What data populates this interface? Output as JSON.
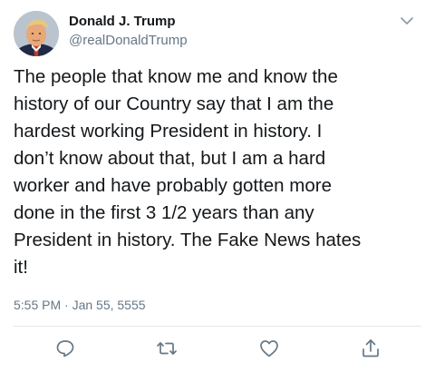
{
  "tweet": {
    "author_name": "Donald J. Trump",
    "author_handle": "@realDonaldTrump",
    "text": "The people that know me and know the\nhistory of our Country say that I am the\nhardest working President in history. I\ndon’t know about that, but I am a hard\nworker and have probably gotten more\ndone in the first 3 1/2 years than any\nPresident in history. The Fake News hates\nit!",
    "timestamp": "5:55 PM · Jan 55, 5555"
  },
  "icons": {
    "avatar": "profile-photo",
    "menu": "chevron-down-icon",
    "reply": "reply-icon",
    "retweet": "retweet-icon",
    "like": "heart-icon",
    "share": "share-icon"
  },
  "colors": {
    "text": "#14171a",
    "secondary": "#657786",
    "divider": "#e1e8ed"
  }
}
